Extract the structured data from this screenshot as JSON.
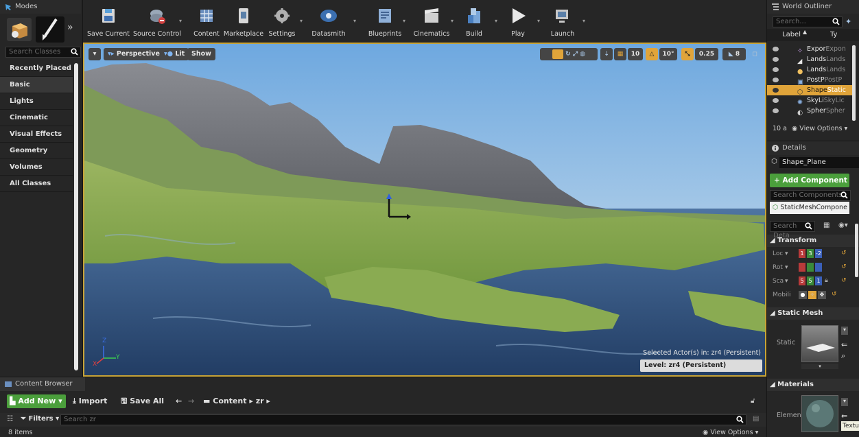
{
  "modes": {
    "tab": "Modes",
    "search_placeholder": "Search Classes",
    "categories": [
      "Recently Placed",
      "Basic",
      "Lights",
      "Cinematic",
      "Visual Effects",
      "Geometry",
      "Volumes",
      "All Classes"
    ]
  },
  "toolbar": {
    "buttons": [
      "Save Current",
      "Source Control",
      "Content",
      "Marketplace",
      "Settings",
      "Datasmith",
      "Blueprints",
      "Cinematics",
      "Build",
      "Play",
      "Launch"
    ]
  },
  "viewport": {
    "perspective": "Perspective",
    "lit": "Lit",
    "show": "Show",
    "grid_snap": "10",
    "rot_snap": "10°",
    "scale_snap": "0.25",
    "camera_speed": "8",
    "selected_actor": "Selected Actor(s) in:  zr4 (Persistent)",
    "level": "Level:  zr4 (Persistent)",
    "axis_z": "Z",
    "axis_x": "X",
    "axis_y": "Y"
  },
  "outliner": {
    "tab": "World Outliner",
    "search_placeholder": "Search...",
    "col_label": "Label",
    "col_type": "Ty",
    "rows": [
      {
        "name": "Expor",
        "type": "Expon"
      },
      {
        "name": "Lands",
        "type": "Lands"
      },
      {
        "name": "Lands",
        "type": "Lands"
      },
      {
        "name": "PostP",
        "type": "PostP"
      },
      {
        "name": "Shape",
        "type": "Static"
      },
      {
        "name": "SkyLi",
        "type": "SkyLic"
      },
      {
        "name": "Spher",
        "type": "Spher"
      }
    ],
    "count": "10 a",
    "view_options": "View Options"
  },
  "details": {
    "tab": "Details",
    "actor_name": "Shape_Plane",
    "add_component": "+ Add Component",
    "search_components": "Search Components",
    "component": "StaticMeshCompone",
    "search_details": "Search Deta",
    "transform": "Transform",
    "loc": "Loc",
    "rot": "Rot",
    "sca": "Sca",
    "mobility": "Mobili",
    "loc_vals": [
      "1",
      "3",
      "-2"
    ],
    "sca_vals": [
      "5",
      "5",
      "1"
    ],
    "static_mesh": "Static Mesh",
    "static_label": "Static",
    "materials": "Materials",
    "element_label": "Elemen",
    "texture_tip": "Textu"
  },
  "content_browser": {
    "tab": "Content Browser",
    "add_new": "Add New",
    "import": "Import",
    "save_all": "Save All",
    "path_root": "Content",
    "path_folder": "zr",
    "filters": "Filters",
    "search_placeholder": "Search zr",
    "items": "8 items",
    "view_options": "View Options"
  },
  "colors": {
    "accent": "#c8a438",
    "add_green": "#4b9f3c",
    "selected": "#e0a43a"
  }
}
